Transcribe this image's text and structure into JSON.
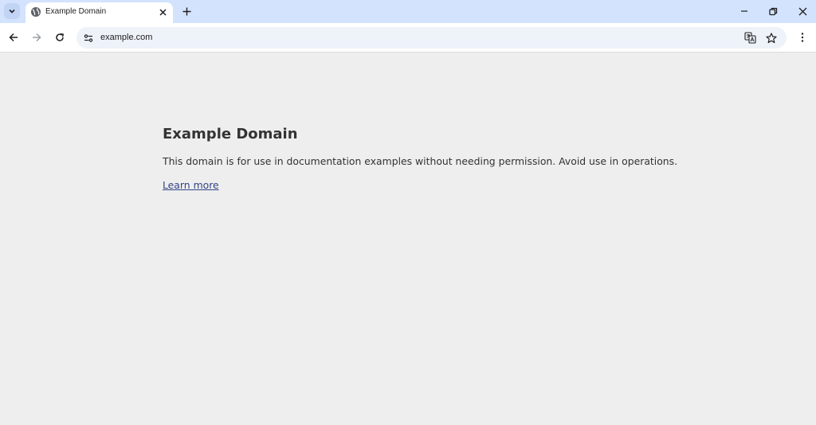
{
  "browser": {
    "tab": {
      "title": "Example Domain"
    },
    "address_bar": {
      "url": "example.com"
    }
  },
  "icons": {
    "tab_search": "chevron-down-icon",
    "favicon": "globe-icon",
    "tab_close": "close-icon",
    "new_tab": "plus-icon",
    "minimize": "minimize-icon",
    "restore": "restore-icon",
    "close": "close-icon",
    "back": "arrow-left-icon",
    "forward": "arrow-right-icon",
    "reload": "reload-icon",
    "site_info": "tune-icon",
    "translate": "translate-icon",
    "bookmark": "star-icon",
    "menu": "kebab-menu-icon"
  },
  "colors": {
    "tabstrip": "#d3e3fd",
    "omnibox": "#eef2f9",
    "page_background": "#eeeeee",
    "text": "#333333",
    "link": "#334488"
  },
  "page": {
    "heading": "Example Domain",
    "paragraph": "This domain is for use in documentation examples without needing permission. Avoid use in operations.",
    "link_text": "Learn more"
  }
}
